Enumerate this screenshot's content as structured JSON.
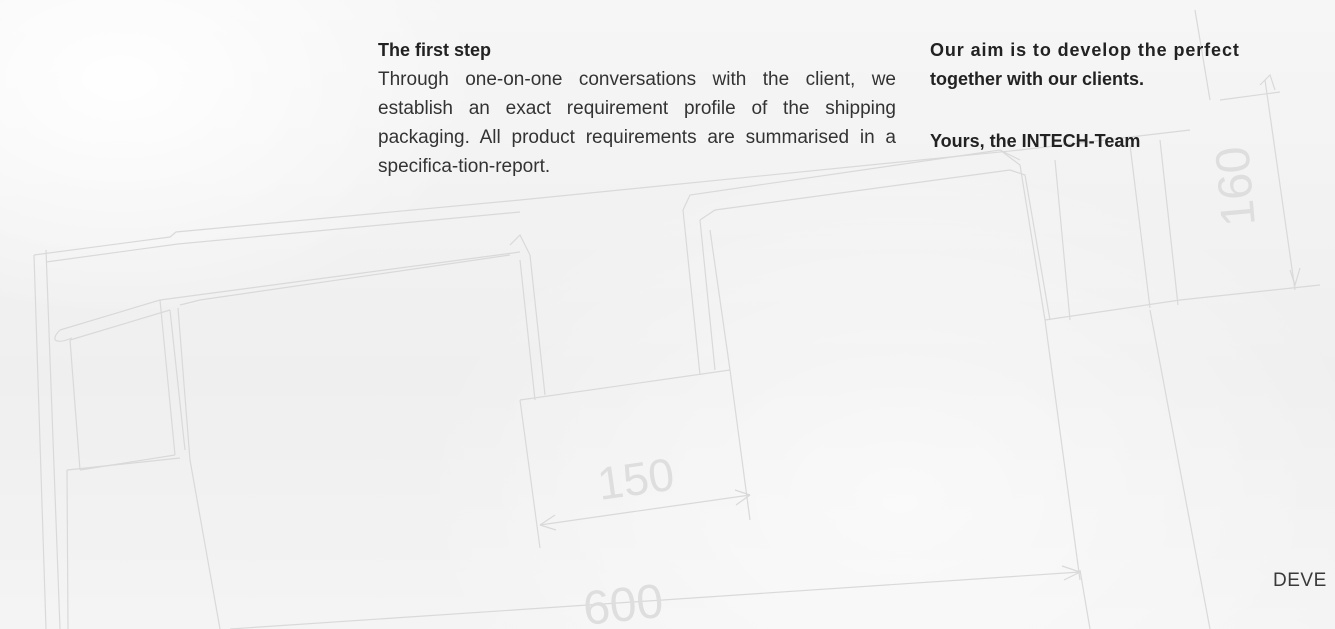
{
  "left_column": {
    "heading": "The first step",
    "body": "Through one-on-one conversations with the client, we establish an exact requirement profile of the shipping packaging. All product requirements are summarised in a specifica-tion-report."
  },
  "right_column": {
    "aim_line1": "Our aim is to develop the perfect",
    "aim_line2": "together with our clients.",
    "signature": "Yours, the INTECH-Team"
  },
  "footer": {
    "label": "DEVE"
  },
  "drawing": {
    "dim_150": "150",
    "dim_600": "600",
    "dim_160": "160"
  }
}
